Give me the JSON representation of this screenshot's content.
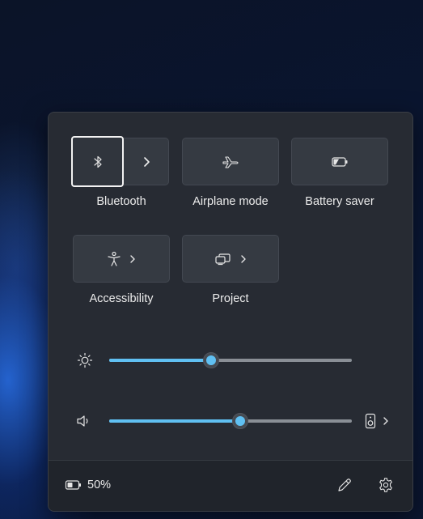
{
  "quick_settings": {
    "tiles": {
      "bluetooth": {
        "label": "Bluetooth",
        "icon": "bluetooth-icon",
        "expand_icon": "chevron-right-icon"
      },
      "airplane": {
        "label": "Airplane mode",
        "icon": "airplane-icon"
      },
      "battery_saver": {
        "label": "Battery saver",
        "icon": "battery-saver-icon"
      },
      "accessibility": {
        "label": "Accessibility",
        "icon": "accessibility-icon",
        "expand_icon": "chevron-right-icon"
      },
      "project": {
        "label": "Project",
        "icon": "project-icon",
        "expand_icon": "chevron-right-icon"
      }
    },
    "brightness": {
      "icon": "brightness-icon",
      "level_percent": 42
    },
    "volume": {
      "icon": "speaker-icon",
      "level_percent": 54,
      "output_icon": "audio-output-device-icon",
      "expand_icon": "chevron-right-icon"
    },
    "footer": {
      "battery_icon": "battery-icon",
      "battery_text": "50%",
      "edit_icon": "pencil-icon",
      "settings_icon": "gear-icon"
    },
    "colors": {
      "accent": "#60c0f2",
      "panel": "#272b33",
      "tile": "#353a42"
    }
  }
}
